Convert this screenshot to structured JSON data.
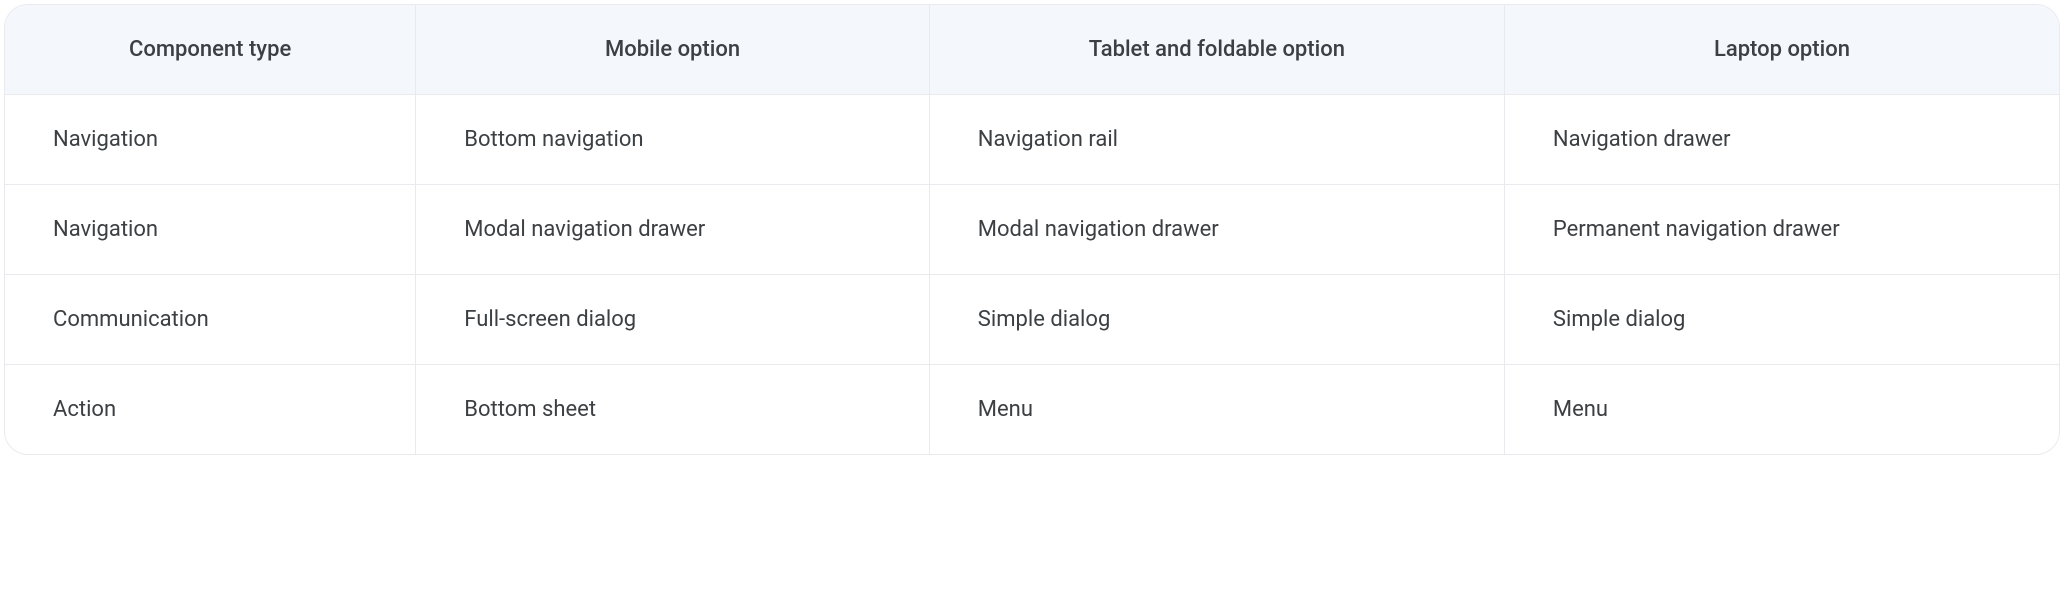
{
  "table": {
    "headers": [
      "Component type",
      "Mobile option",
      "Tablet and foldable option",
      "Laptop option"
    ],
    "rows": [
      [
        "Navigation",
        "Bottom navigation",
        "Navigation rail",
        "Navigation drawer"
      ],
      [
        "Navigation",
        "Modal navigation drawer",
        "Modal navigation drawer",
        "Permanent navigation drawer"
      ],
      [
        "Communication",
        "Full-screen dialog",
        "Simple dialog",
        "Simple dialog"
      ],
      [
        "Action",
        "Bottom sheet",
        "Menu",
        "Menu"
      ]
    ]
  }
}
